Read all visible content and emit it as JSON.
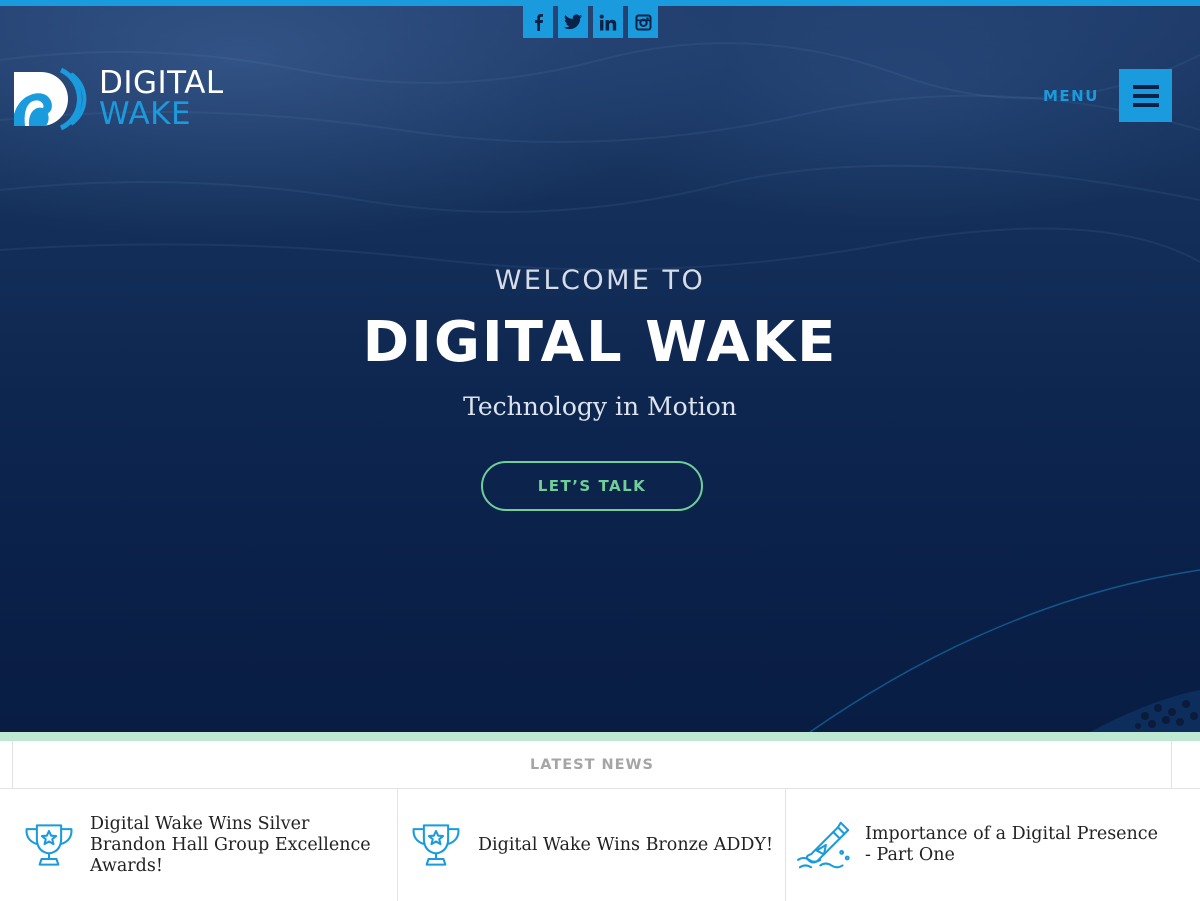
{
  "social": {
    "items": [
      {
        "name": "facebook",
        "glyph": "f"
      },
      {
        "name": "twitter",
        "glyph": "twitter-bird"
      },
      {
        "name": "linkedin",
        "glyph": "in"
      },
      {
        "name": "instagram",
        "glyph": "instagram-camera"
      }
    ]
  },
  "brand": {
    "line1": "DIGITAL",
    "line2": "WAKE"
  },
  "nav": {
    "menu_label": "MENU"
  },
  "hero": {
    "welcome": "WELCOME TO",
    "headline": "DIGITAL WAKE",
    "tagline": "Technology in Motion",
    "cta_label": "LET’S TALK"
  },
  "news": {
    "section_title": "LATEST NEWS",
    "items": [
      {
        "title": "Digital Wake Wins Silver Brandon Hall Group Excellence Awards!",
        "icon": "trophy-icon"
      },
      {
        "title": "Digital Wake Wins Bronze ADDY!",
        "icon": "trophy-icon"
      },
      {
        "title": "Importance of a Digital Presence - Part One",
        "icon": "message-bottle-icon"
      }
    ]
  },
  "colors": {
    "accent_blue": "#1a9bdd",
    "cta_green": "#6fcf97",
    "hero_navy": "#0d2650",
    "strip_green": "#bfe8d2"
  }
}
